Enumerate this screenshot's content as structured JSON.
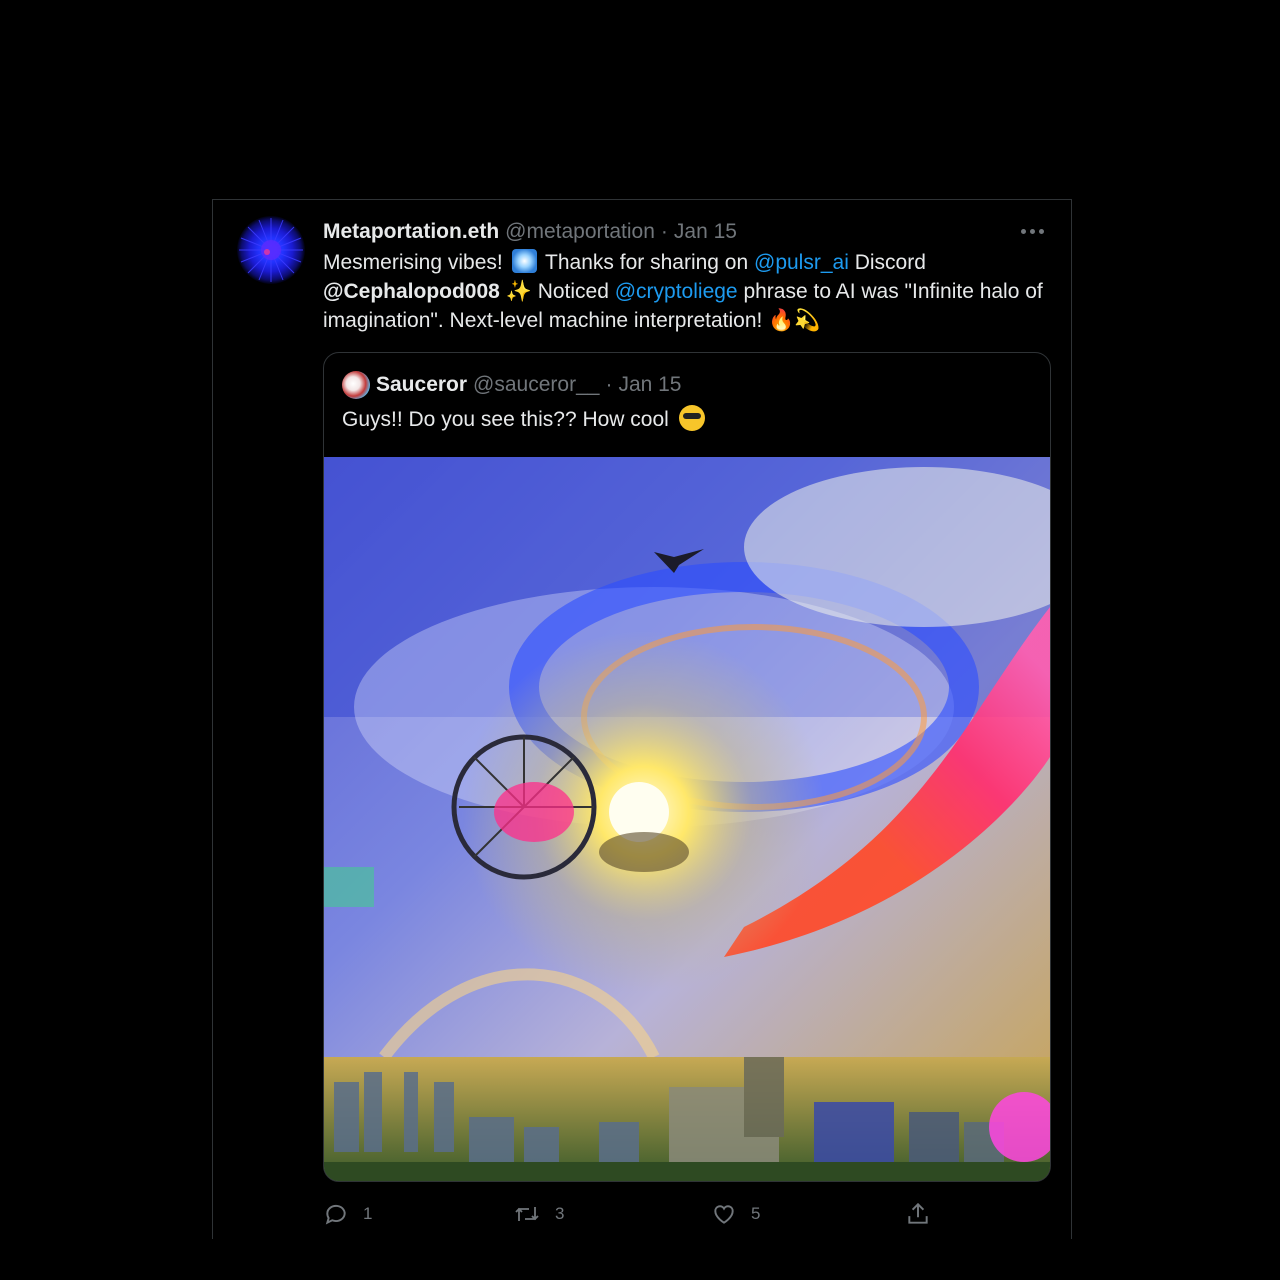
{
  "tweet": {
    "author": {
      "display_name": "Metaportation.eth",
      "handle": "@metaportation",
      "date": "Jan 15",
      "avatar_icon": "fractal-burst-avatar"
    },
    "text": {
      "p1": "Mesmerising vibes!",
      "p2": "Thanks for sharing on",
      "mention_pulsr": "@pulsr_ai",
      "p3": "Discord",
      "mention_cephalopod": "@Cephalopod008",
      "p4": "Noticed",
      "mention_cryptoliege": "@cryptoliege",
      "p5": "phrase to AI was \"Infinite halo of imagination\". Next-level machine interpretation!"
    },
    "emojis": [
      "sparkler-emoji",
      "sparkles-emoji",
      "fire-emoji",
      "dizzy-emoji"
    ],
    "separator": "·"
  },
  "quoted_tweet": {
    "display_name": "Sauceror",
    "handle": "@sauceror__",
    "date": "Jan 15",
    "text": "Guys!! Do you see this?? How cool",
    "emoji": "sunglasses-emoji",
    "media_description_icon": "ai-generated-image"
  },
  "actions": {
    "reply_count": "1",
    "retweet_count": "3",
    "like_count": "5"
  },
  "colors": {
    "background": "#000000",
    "text": "#e7e9ea",
    "muted": "#71767b",
    "link": "#1d9bf0",
    "border": "#2f3336"
  }
}
